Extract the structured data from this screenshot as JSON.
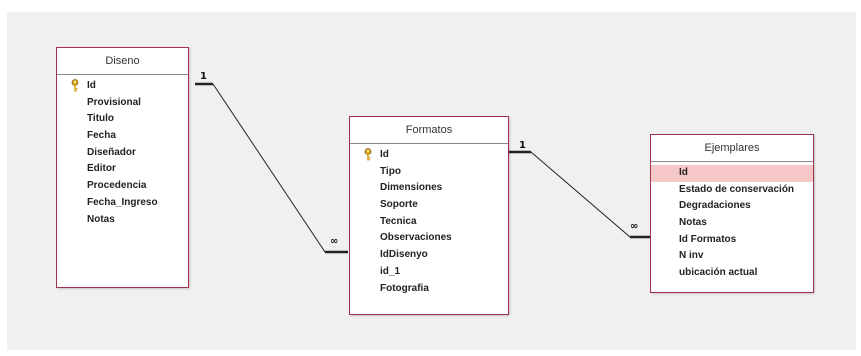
{
  "colors": {
    "canvas": "#f0f0f0",
    "table_border": "#a3334a",
    "selected_row": "#f6c7c7",
    "line": "#222222"
  },
  "tables": [
    {
      "title": "Diseno",
      "fields": [
        {
          "name": "Id",
          "key": true
        },
        {
          "name": "Provisional"
        },
        {
          "name": "Titulo"
        },
        {
          "name": "Fecha"
        },
        {
          "name": "Diseñador"
        },
        {
          "name": "Editor"
        },
        {
          "name": "Procedencia"
        },
        {
          "name": "Fecha_Ingreso"
        },
        {
          "name": "Notas"
        }
      ]
    },
    {
      "title": "Formatos",
      "fields": [
        {
          "name": "Id",
          "key": true
        },
        {
          "name": "Tipo"
        },
        {
          "name": "Dimensiones"
        },
        {
          "name": "Soporte"
        },
        {
          "name": "Tecnica"
        },
        {
          "name": "Observaciones"
        },
        {
          "name": "IdDisenyo"
        },
        {
          "name": "id_1"
        },
        {
          "name": "Fotografia"
        }
      ]
    },
    {
      "title": "Ejemplares",
      "fields": [
        {
          "name": "Id",
          "selected": true
        },
        {
          "name": "Estado de conservación"
        },
        {
          "name": "Degradaciones"
        },
        {
          "name": "Notas"
        },
        {
          "name": "Id Formatos"
        },
        {
          "name": "N inv"
        },
        {
          "name": "ubicación actual"
        }
      ]
    }
  ],
  "relationships": [
    {
      "from": "Diseno",
      "to": "Formatos",
      "one_label": "1",
      "many_label": "∞"
    },
    {
      "from": "Formatos",
      "to": "Ejemplares",
      "one_label": "1",
      "many_label": "∞"
    }
  ]
}
